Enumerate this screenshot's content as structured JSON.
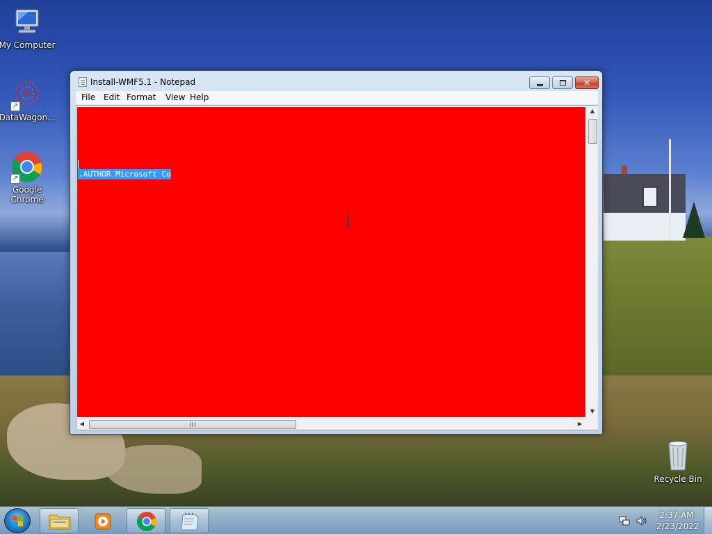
{
  "desktop": {
    "icons": [
      {
        "label": "My Computer",
        "icon": "computer-icon"
      },
      {
        "label": "DataWagon...",
        "icon": "datawagon-icon"
      },
      {
        "label": "Google\nChrome",
        "icon": "chrome-icon"
      },
      {
        "label": "Recycle Bin",
        "icon": "recycle-bin-icon"
      }
    ]
  },
  "notepad": {
    "title": "Install-WMF5.1 - Notepad",
    "menu": [
      "File",
      "Edit",
      "Format",
      "View",
      "Help"
    ],
    "selected_text": ".AUTHOR Microsoft Co",
    "editor_background": "#ff0000",
    "selection_color": "#3399ff",
    "caption_buttons": {
      "minimize": "minimize",
      "maximize": "maximize",
      "close": "close"
    }
  },
  "taskbar": {
    "items": [
      {
        "name": "start-button",
        "icon": "windows-start-icon"
      },
      {
        "name": "explorer",
        "icon": "folder-icon"
      },
      {
        "name": "media-player",
        "icon": "media-player-icon"
      },
      {
        "name": "chrome",
        "icon": "chrome-icon"
      },
      {
        "name": "notepad",
        "icon": "notepad-icon"
      }
    ],
    "clock": {
      "time": "2:37 AM",
      "date": "2/23/2022"
    }
  }
}
